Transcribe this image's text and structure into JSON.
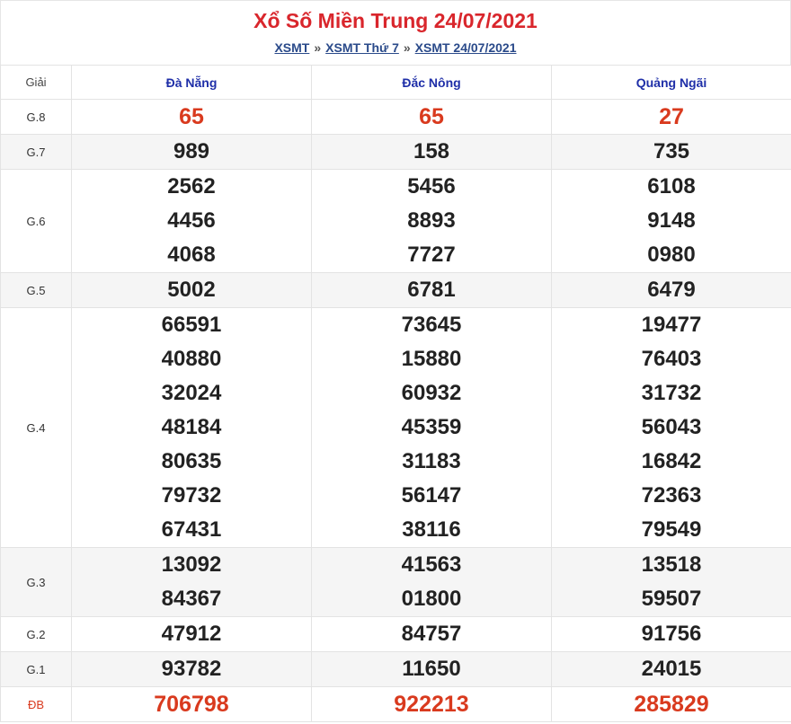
{
  "title": "Xổ Số Miền Trung 24/07/2021",
  "breadcrumbs": [
    "XSMT",
    "XSMT Thứ 7",
    "XSMT 24/07/2021"
  ],
  "breadcrumb_separator": "»",
  "table": {
    "label_header": "Giải",
    "provinces": [
      "Đà Nẵng",
      "Đắc Nông",
      "Quảng Ngãi"
    ],
    "prizes": [
      {
        "label": "G.8",
        "results": [
          [
            "65"
          ],
          [
            "65"
          ],
          [
            "27"
          ]
        ]
      },
      {
        "label": "G.7",
        "results": [
          [
            "989"
          ],
          [
            "158"
          ],
          [
            "735"
          ]
        ]
      },
      {
        "label": "G.6",
        "results": [
          [
            "2562",
            "4456",
            "4068"
          ],
          [
            "5456",
            "8893",
            "7727"
          ],
          [
            "6108",
            "9148",
            "0980"
          ]
        ]
      },
      {
        "label": "G.5",
        "results": [
          [
            "5002"
          ],
          [
            "6781"
          ],
          [
            "6479"
          ]
        ]
      },
      {
        "label": "G.4",
        "results": [
          [
            "66591",
            "40880",
            "32024",
            "48184",
            "80635",
            "79732",
            "67431"
          ],
          [
            "73645",
            "15880",
            "60932",
            "45359",
            "31183",
            "56147",
            "38116"
          ],
          [
            "19477",
            "76403",
            "31732",
            "56043",
            "16842",
            "72363",
            "79549"
          ]
        ]
      },
      {
        "label": "G.3",
        "results": [
          [
            "13092",
            "84367"
          ],
          [
            "41563",
            "01800"
          ],
          [
            "13518",
            "59507"
          ]
        ]
      },
      {
        "label": "G.2",
        "results": [
          [
            "47912"
          ],
          [
            "84757"
          ],
          [
            "91756"
          ]
        ]
      },
      {
        "label": "G.1",
        "results": [
          [
            "93782"
          ],
          [
            "11650"
          ],
          [
            "24015"
          ]
        ]
      },
      {
        "label": "ĐB",
        "results": [
          [
            "706798"
          ],
          [
            "922213"
          ],
          [
            "285829"
          ]
        ]
      }
    ]
  },
  "colors": {
    "title": "#d9262c",
    "province_header": "#1f2fa8",
    "highlight_numbers": "#d93a1e",
    "alt_row_bg": "#f5f5f5"
  }
}
